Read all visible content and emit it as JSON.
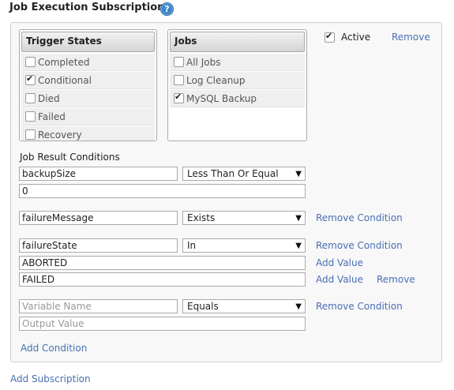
{
  "header": {
    "title": "Job Execution Subscriptions",
    "help_icon": "?"
  },
  "subscription": {
    "trigger_states": {
      "title": "Trigger States",
      "items": [
        {
          "label": "Completed",
          "checked": false
        },
        {
          "label": "Conditional",
          "checked": true
        },
        {
          "label": "Died",
          "checked": false
        },
        {
          "label": "Failed",
          "checked": false
        },
        {
          "label": "Recovery",
          "checked": false
        }
      ]
    },
    "jobs": {
      "title": "Jobs",
      "items": [
        {
          "label": "All Jobs",
          "checked": false
        },
        {
          "label": "Log Cleanup",
          "checked": false
        },
        {
          "label": "MySQL Backup",
          "checked": true
        }
      ]
    },
    "active_label": "Active",
    "active_checked": true,
    "remove_label": "Remove",
    "conditions_title": "Job Result Conditions",
    "conditions": [
      {
        "variable": "backupSize",
        "operator": "Less Than Or Equal",
        "values": [
          "0"
        ]
      },
      {
        "variable": "failureMessage",
        "operator": "Exists",
        "remove_condition": "Remove Condition"
      },
      {
        "variable": "failureState",
        "operator": "In",
        "remove_condition": "Remove Condition",
        "values": [
          "ABORTED",
          "FAILED"
        ],
        "add_value": "Add Value",
        "remove_value": "Remove"
      },
      {
        "variable_placeholder": "Variable Name",
        "operator": "Equals",
        "remove_condition": "Remove Condition",
        "value_placeholder": "Output Value"
      }
    ],
    "add_condition": "Add Condition"
  },
  "add_subscription": "Add Subscription"
}
